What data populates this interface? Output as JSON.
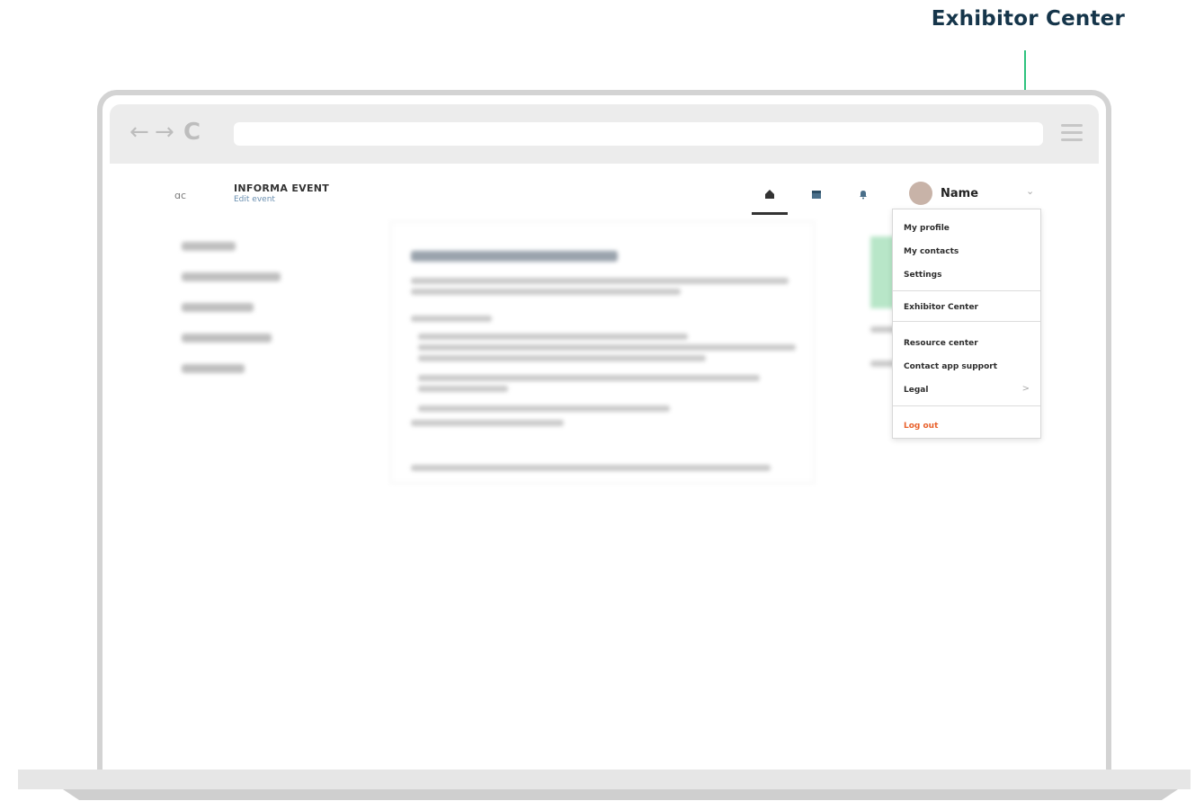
{
  "callout": {
    "label": "Exhibitor Center",
    "accent_color": "#2ec27e"
  },
  "browser": {
    "back_icon": "←",
    "forward_icon": "→",
    "reload_icon": "C",
    "url": ""
  },
  "app": {
    "logo_text": "ɑc",
    "title": "INFORMA EVENT",
    "subtitle": "Edit event",
    "top_icons": [
      "home-icon",
      "calendar-icon",
      "bell-icon"
    ],
    "user": {
      "name": "Name",
      "chevron": "⌄"
    }
  },
  "dropdown": {
    "items": [
      {
        "label": "My profile"
      },
      {
        "label": "My contacts"
      },
      {
        "label": "Settings"
      },
      {
        "label": "Exhibitor Center"
      },
      {
        "label": "Resource center"
      },
      {
        "label": "Contact app support"
      },
      {
        "label": "Legal",
        "chevron": ">"
      },
      {
        "label": "Log out",
        "color": "#e8612c"
      }
    ]
  }
}
